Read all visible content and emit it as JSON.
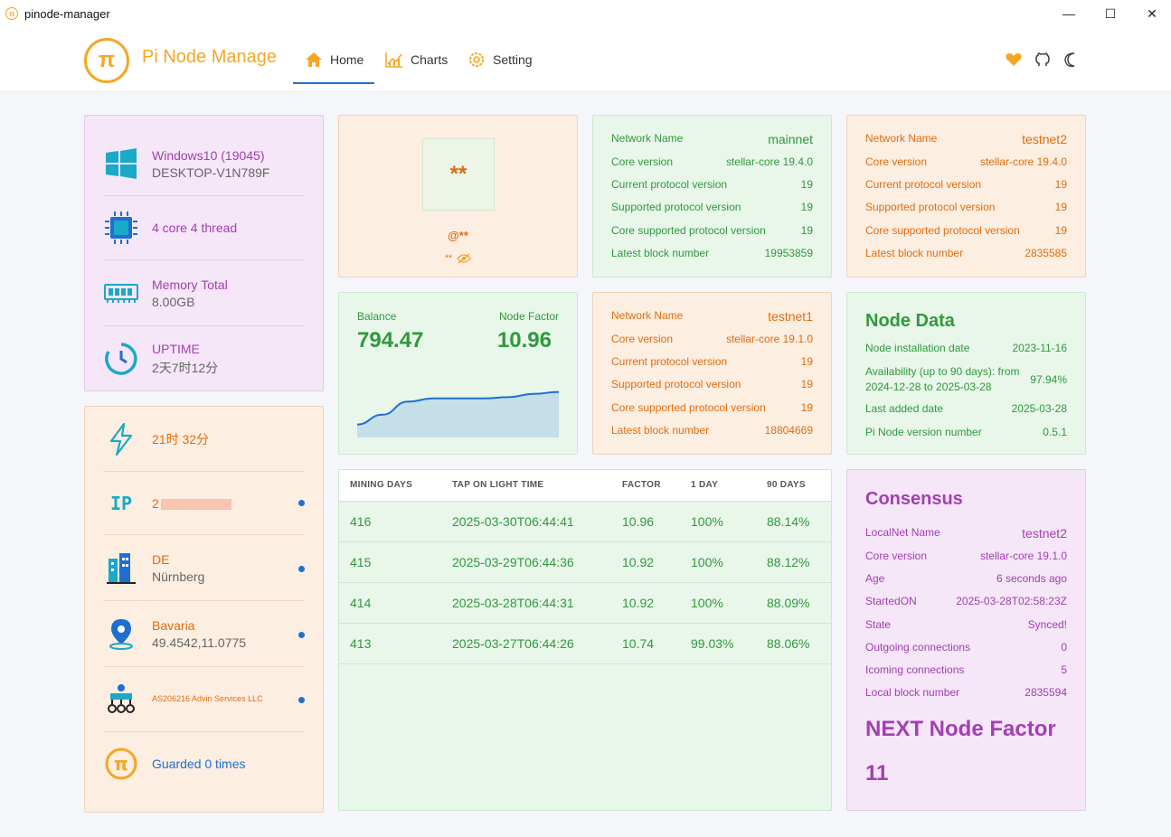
{
  "window": {
    "title": "pinode-manager",
    "minimize": "—",
    "maximize": "☐",
    "close": "✕"
  },
  "nav": {
    "brand": "Pi Node Manage",
    "logo_letter": "π",
    "tabs": [
      {
        "label": "Home",
        "icon": "home-icon",
        "active": true
      },
      {
        "label": "Charts",
        "icon": "chart-icon"
      },
      {
        "label": "Setting",
        "icon": "gear-icon"
      }
    ],
    "right_icons": [
      "heart-icon",
      "github-icon",
      "moon-icon"
    ]
  },
  "system": {
    "os": "Windows10 (19045)",
    "host": "DESKTOP-V1N789F",
    "cpu": "4 core 4 thread",
    "memory_label": "Memory Total",
    "memory_value": "8.00GB",
    "uptime_label": "UPTIME",
    "uptime_value": "2天7时12分"
  },
  "network_info": {
    "uptime": "21时 32分",
    "ip_label": "IP",
    "ip_value": "2",
    "country": "DE",
    "city": "Nürnberg",
    "region": "Bavaria",
    "coords": "49.4542,11.0775",
    "asn": "AS206216 Advin Services LLC",
    "guarded": "Guarded 0 times"
  },
  "profile": {
    "avatar_text": "**",
    "username": "@**",
    "hidden": "**"
  },
  "balance": {
    "balance_label": "Balance",
    "balance_value": "794.47",
    "factor_label": "Node Factor",
    "factor_value": "10.96"
  },
  "balance_chart": {
    "chart_data": {
      "type": "area",
      "values": [
        0.2,
        0.35,
        0.55,
        0.6,
        0.6,
        0.6,
        0.62,
        0.67,
        0.7
      ]
    }
  },
  "mainnet": {
    "rows": [
      {
        "label": "Network Name",
        "value": "mainnet"
      },
      {
        "label": "Core version",
        "value": "stellar-core 19.4.0"
      },
      {
        "label": "Current protocol version",
        "value": "19"
      },
      {
        "label": "Supported protocol version",
        "value": "19"
      },
      {
        "label": "Core supported protocol version",
        "value": "19"
      },
      {
        "label": "Latest block number",
        "value": "19953859"
      }
    ]
  },
  "testnet2": {
    "rows": [
      {
        "label": "Network Name",
        "value": "testnet2"
      },
      {
        "label": "Core version",
        "value": "stellar-core 19.4.0"
      },
      {
        "label": "Current protocol version",
        "value": "19"
      },
      {
        "label": "Supported protocol version",
        "value": "19"
      },
      {
        "label": "Core supported protocol version",
        "value": "19"
      },
      {
        "label": "Latest block number",
        "value": "2835585"
      }
    ]
  },
  "testnet1": {
    "rows": [
      {
        "label": "Network Name",
        "value": "testnet1"
      },
      {
        "label": "Core version",
        "value": "stellar-core 19.1.0"
      },
      {
        "label": "Current protocol version",
        "value": "19"
      },
      {
        "label": "Supported protocol version",
        "value": "19"
      },
      {
        "label": "Core supported protocol version",
        "value": "19"
      },
      {
        "label": "Latest block number",
        "value": "18804669"
      }
    ]
  },
  "node_data": {
    "title": "Node Data",
    "install_label": "Node installation date",
    "install_value": "2023-11-16",
    "avail_label": "Availability (up to 90 days): from 2024-12-28 to 2025-03-28",
    "avail_value": "97.94%",
    "last_label": "Last added date",
    "last_value": "2025-03-28",
    "version_label": "Pi Node version number",
    "version_value": "0.5.1"
  },
  "mining": {
    "headers": [
      "MINING DAYS",
      "TAP ON LIGHT TIME",
      "FACTOR",
      "1 DAY",
      "90 DAYS"
    ],
    "rows": [
      [
        "416",
        "2025-03-30T06:44:41",
        "10.96",
        "100%",
        "88.14%"
      ],
      [
        "415",
        "2025-03-29T06:44:36",
        "10.92",
        "100%",
        "88.12%"
      ],
      [
        "414",
        "2025-03-28T06:44:31",
        "10.92",
        "100%",
        "88.09%"
      ],
      [
        "413",
        "2025-03-27T06:44:26",
        "10.74",
        "99.03%",
        "88.06%"
      ]
    ]
  },
  "consensus": {
    "title": "Consensus",
    "rows": [
      {
        "label": "LocalNet Name",
        "value": "testnet2"
      },
      {
        "label": "Core version",
        "value": "stellar-core 19.1.0"
      },
      {
        "label": "Age",
        "value": "6 seconds ago"
      },
      {
        "label": "StartedON",
        "value": "2025-03-28T02:58:23Z"
      },
      {
        "label": "State",
        "value": "Synced!"
      },
      {
        "label": "Outgoing connections",
        "value": "0"
      },
      {
        "label": "Icoming connections",
        "value": "5"
      },
      {
        "label": "Local block number",
        "value": "2835594"
      }
    ],
    "next_label": "NEXT Node Factor",
    "next_value": "11"
  },
  "colors": {
    "accent": "#f5a623",
    "purple": "#a33fb3",
    "green": "#2e9a3c",
    "orange": "#e36c0c",
    "blue": "#1e6fd0"
  }
}
